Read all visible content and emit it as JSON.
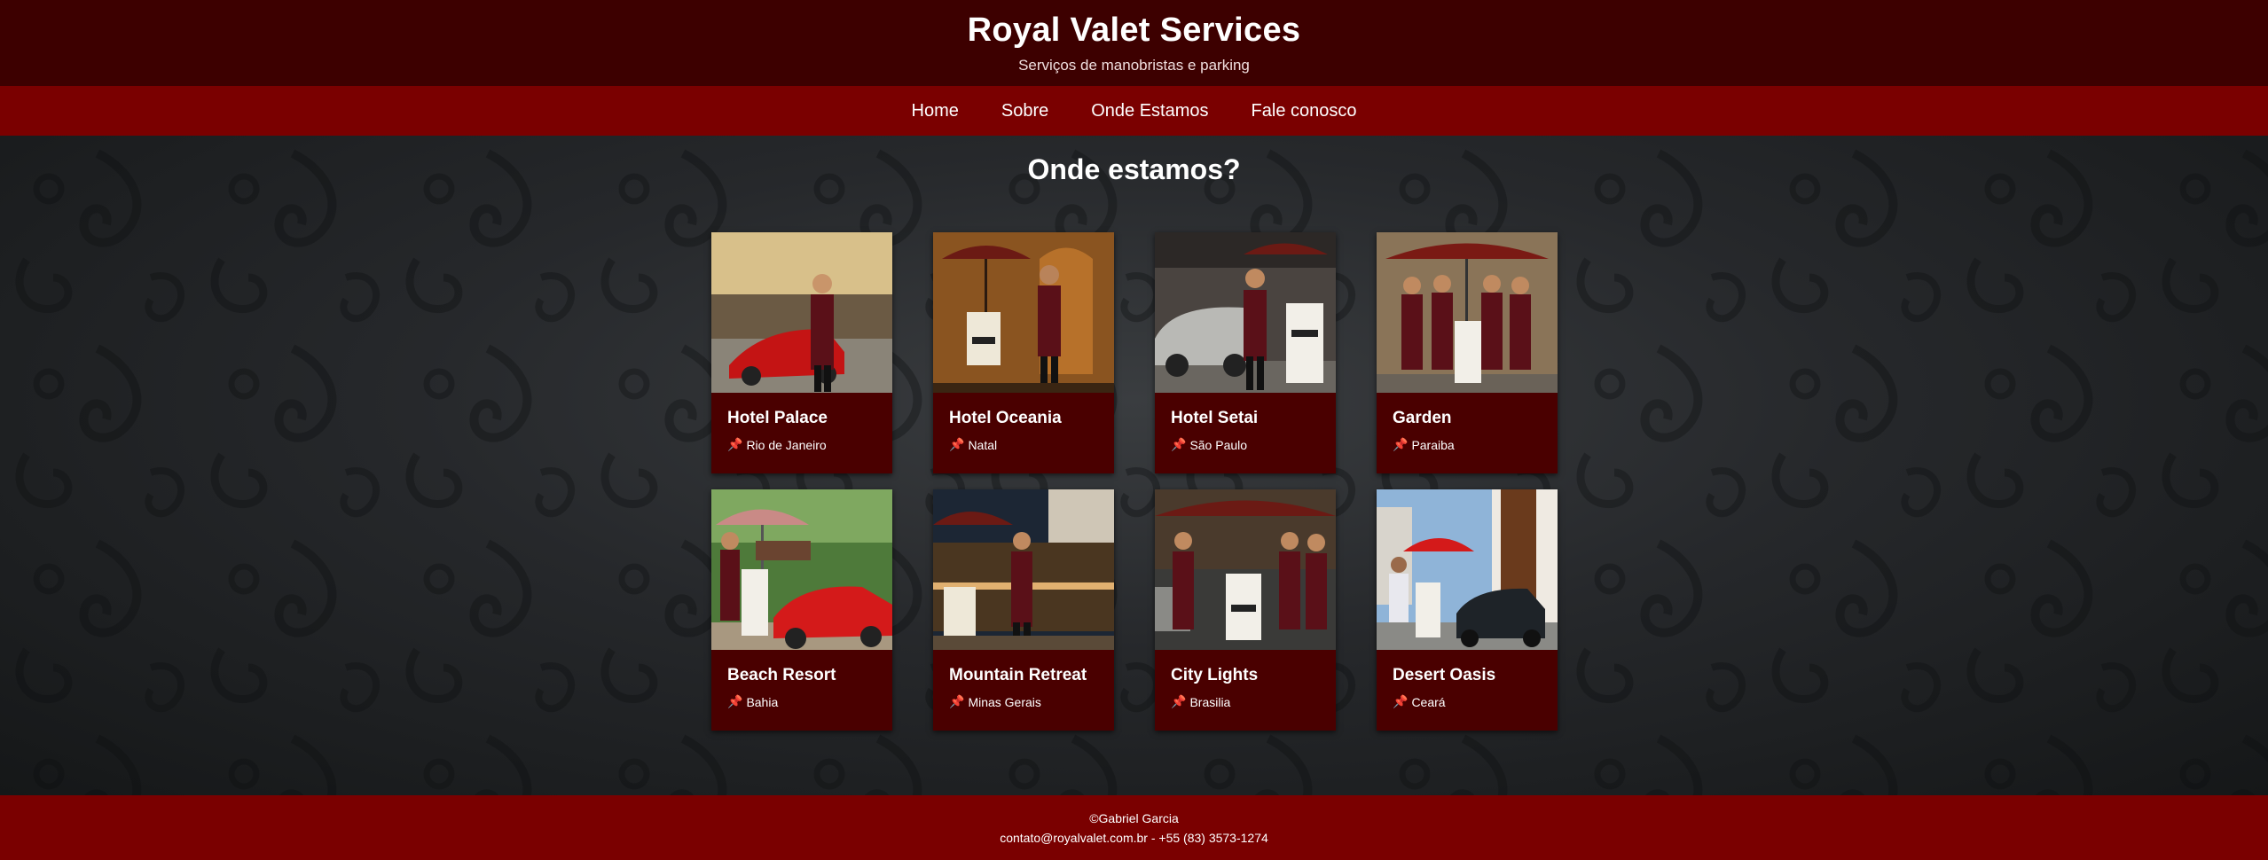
{
  "header": {
    "title": "Royal Valet Services",
    "subtitle": "Serviços de manobristas e parking"
  },
  "nav": {
    "items": [
      "Home",
      "Sobre",
      "Onde Estamos",
      "Fale conosco"
    ]
  },
  "main": {
    "heading": "Onde estamos?",
    "locations": [
      {
        "name": "Hotel Palace",
        "city": "Rio de Janeiro",
        "icon": "pin-icon"
      },
      {
        "name": "Hotel Oceania",
        "city": "Natal",
        "icon": "pin-icon"
      },
      {
        "name": "Hotel Setai",
        "city": "São Paulo",
        "icon": "pin-icon"
      },
      {
        "name": "Garden",
        "city": "Paraiba",
        "icon": "pin-icon"
      },
      {
        "name": "Beach Resort",
        "city": "Bahia",
        "icon": "pin-icon"
      },
      {
        "name": "Mountain Retreat",
        "city": "Minas Gerais",
        "icon": "pin-icon"
      },
      {
        "name": "City Lights",
        "city": "Brasilia",
        "icon": "pin-icon"
      },
      {
        "name": "Desert Oasis",
        "city": "Ceará",
        "icon": "pin-icon"
      }
    ]
  },
  "footer": {
    "copyright": "©Gabriel Garcia",
    "contact": "contato@royalvalet.com.br - +55 (83) 3573-1274"
  },
  "colors": {
    "header_bg": "#3d0000",
    "nav_bg": "#7a0000",
    "card_bg": "#4a0000",
    "footer_bg": "#7a0000"
  }
}
